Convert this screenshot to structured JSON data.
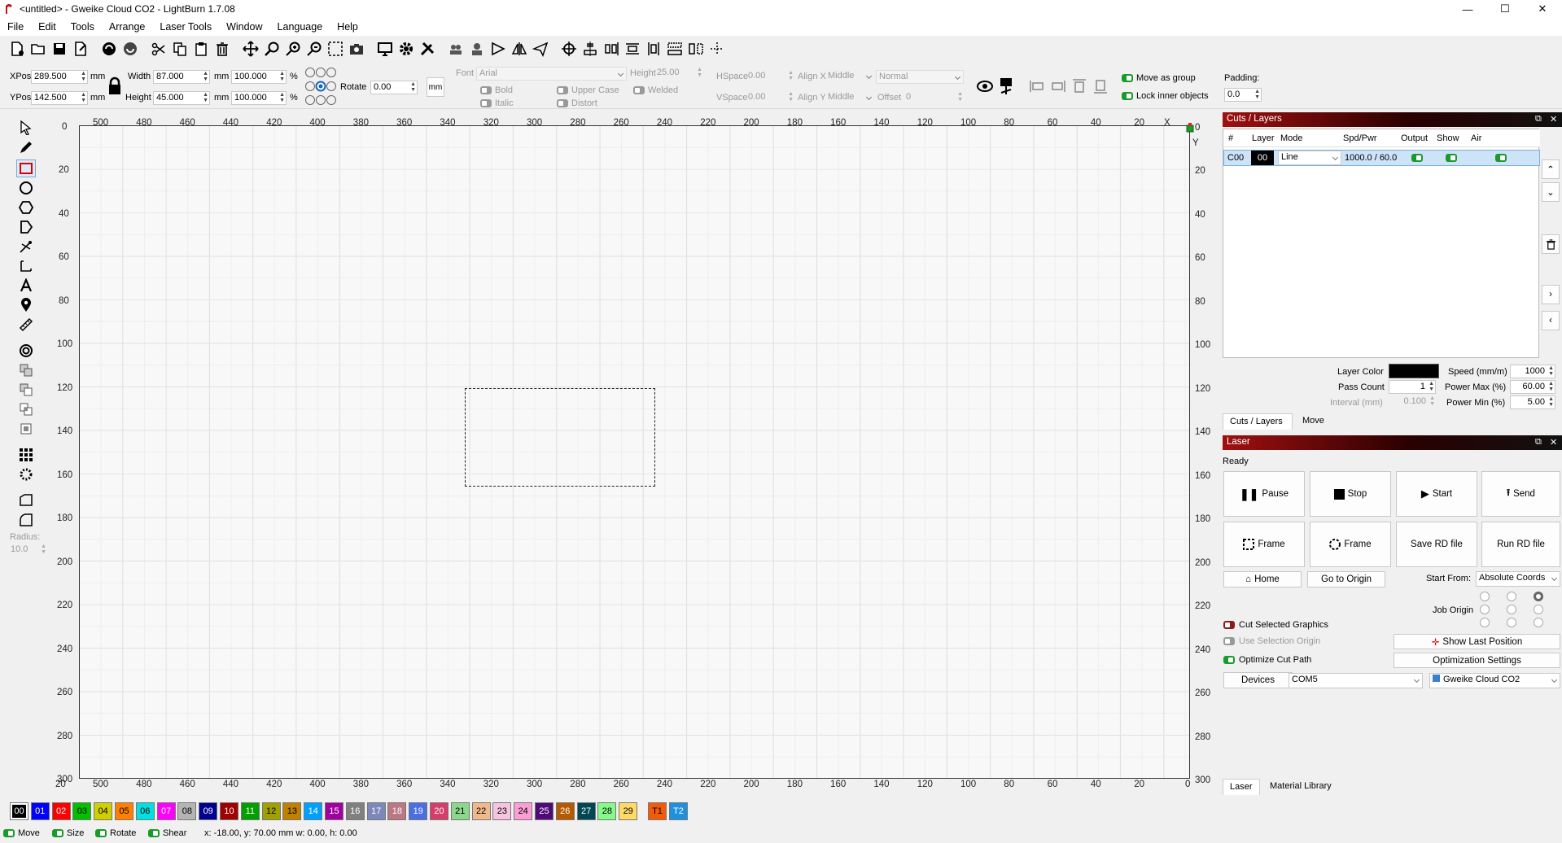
{
  "window": {
    "title": "<untitled> - Gweike Cloud CO2 - LightBurn 1.7.08",
    "minimize": "—",
    "maximize": "☐",
    "close": "✕"
  },
  "menu": [
    "File",
    "Edit",
    "Tools",
    "Arrange",
    "Laser Tools",
    "Window",
    "Language",
    "Help"
  ],
  "props": {
    "xpos_label": "XPos",
    "xpos": "289.500",
    "ypos_label": "YPos",
    "ypos": "142.500",
    "unit": "mm",
    "width_label": "Width",
    "width": "87.000",
    "height_label": "Height",
    "height": "45.000",
    "scale_w": "100.000",
    "scale_h": "100.000",
    "pct": "%",
    "rotate_label": "Rotate",
    "rotate": "0.00",
    "mm_btn": "mm"
  },
  "text_props": {
    "font_label": "Font",
    "font": "Arial",
    "height_label": "Height",
    "height": "25.00",
    "hspace_label": "HSpace",
    "hspace": "0.00",
    "vspace_label": "VSpace",
    "vspace": "0.00",
    "alignx_label": "Align X",
    "alignx": "Middle",
    "aligny_label": "Align Y",
    "aligny": "Middle",
    "style": "Normal",
    "offset_label": "Offset",
    "offset": "0",
    "bold": "Bold",
    "italic": "Italic",
    "upper": "Upper Case",
    "distort": "Distort",
    "welded": "Welded"
  },
  "group": {
    "move_as_group": "Move as group",
    "lock_inner": "Lock inner objects",
    "padding_label": "Padding:",
    "padding": "0.0"
  },
  "left": {
    "radius_label": "Radius:",
    "radius": "10.0"
  },
  "ruler": {
    "top": [
      "500",
      "480",
      "460",
      "440",
      "420",
      "400",
      "380",
      "360",
      "340",
      "320",
      "300",
      "280",
      "260",
      "240",
      "220",
      "200",
      "180",
      "160",
      "140",
      "120",
      "100",
      "80",
      "60",
      "40",
      "20",
      "X"
    ],
    "bottom": [
      "20",
      "500",
      "480",
      "460",
      "440",
      "420",
      "400",
      "380",
      "360",
      "340",
      "320",
      "300",
      "280",
      "260",
      "240",
      "220",
      "200",
      "180",
      "160",
      "140",
      "120",
      "100",
      "80",
      "60",
      "40",
      "20",
      "0"
    ],
    "left": [
      "0",
      "20",
      "40",
      "60",
      "80",
      "100",
      "120",
      "140",
      "160",
      "180",
      "200",
      "220",
      "240",
      "260",
      "280",
      "300"
    ],
    "right": [
      "0",
      "20",
      "40",
      "60",
      "80",
      "100",
      "120",
      "140",
      "160",
      "180",
      "200",
      "220",
      "240",
      "260",
      "280",
      "300"
    ],
    "y_label": "Y"
  },
  "cuts": {
    "title": "Cuts / Layers",
    "headers": [
      "#",
      "Layer",
      "Mode",
      "Spd/Pwr",
      "Output",
      "Show",
      "Air"
    ],
    "row": {
      "num": "C00",
      "layer": "00",
      "mode": "Line",
      "spdpwr": "1000.0 / 60.0"
    },
    "layer_color_label": "Layer Color",
    "speed_label": "Speed (mm/m)",
    "speed": "1000",
    "pass_label": "Pass Count",
    "pass": "1",
    "powmax_label": "Power Max (%)",
    "powmax": "60.00",
    "interval_label": "Interval (mm)",
    "interval": "0.100",
    "powmin_label": "Power Min (%)",
    "powmin": "5.00",
    "tabs": [
      "Cuts / Layers",
      "Move"
    ]
  },
  "laser": {
    "title": "Laser",
    "status": "Ready",
    "pause": "Pause",
    "stop": "Stop",
    "start": "Start",
    "send": "Send",
    "frame1": "Frame",
    "frame2": "Frame",
    "save_rd": "Save RD file",
    "run_rd": "Run RD file",
    "home": "Home",
    "go_origin": "Go to Origin",
    "start_from_label": "Start From:",
    "start_from": "Absolute Coords",
    "job_origin": "Job Origin",
    "cut_selected": "Cut Selected Graphics",
    "use_sel_origin": "Use Selection Origin",
    "optimize": "Optimize Cut Path",
    "show_last": "Show Last Position",
    "opt_settings": "Optimization Settings",
    "devices": "Devices",
    "port": "COM5",
    "device": "Gweike Cloud CO2",
    "tabs": [
      "Laser",
      "Material Library"
    ]
  },
  "palette": [
    {
      "l": "00",
      "c": "#000000",
      "t": "#fff"
    },
    {
      "l": "01",
      "c": "#0000ff",
      "t": "#fff"
    },
    {
      "l": "02",
      "c": "#ff0000",
      "t": "#fff"
    },
    {
      "l": "03",
      "c": "#00c000",
      "t": "#000"
    },
    {
      "l": "04",
      "c": "#d0d000",
      "t": "#000"
    },
    {
      "l": "05",
      "c": "#ff8000",
      "t": "#000"
    },
    {
      "l": "06",
      "c": "#00e0e0",
      "t": "#000"
    },
    {
      "l": "07",
      "c": "#ff00ff",
      "t": "#fff"
    },
    {
      "l": "08",
      "c": "#b4b4b4",
      "t": "#000"
    },
    {
      "l": "09",
      "c": "#000090",
      "t": "#fff"
    },
    {
      "l": "10",
      "c": "#a00000",
      "t": "#fff"
    },
    {
      "l": "11",
      "c": "#00a000",
      "t": "#fff"
    },
    {
      "l": "12",
      "c": "#a0a000",
      "t": "#000"
    },
    {
      "l": "13",
      "c": "#c08000",
      "t": "#000"
    },
    {
      "l": "14",
      "c": "#00a0ff",
      "t": "#fff"
    },
    {
      "l": "15",
      "c": "#a000a0",
      "t": "#fff"
    },
    {
      "l": "16",
      "c": "#808080",
      "t": "#fff"
    },
    {
      "l": "17",
      "c": "#7d87b9",
      "t": "#fff"
    },
    {
      "l": "18",
      "c": "#bb7784",
      "t": "#fff"
    },
    {
      "l": "19",
      "c": "#4a6fe3",
      "t": "#fff"
    },
    {
      "l": "20",
      "c": "#d33f6a",
      "t": "#fff"
    },
    {
      "l": "21",
      "c": "#8cd78c",
      "t": "#000"
    },
    {
      "l": "22",
      "c": "#f0b98d",
      "t": "#000"
    },
    {
      "l": "23",
      "c": "#f6c4e1",
      "t": "#000"
    },
    {
      "l": "24",
      "c": "#fa9ed4",
      "t": "#000"
    },
    {
      "l": "25",
      "c": "#500a78",
      "t": "#fff"
    },
    {
      "l": "26",
      "c": "#b45a00",
      "t": "#fff"
    },
    {
      "l": "27",
      "c": "#004754",
      "t": "#fff"
    },
    {
      "l": "28",
      "c": "#86fa88",
      "t": "#000"
    },
    {
      "l": "29",
      "c": "#ffdb66",
      "t": "#000"
    },
    {
      "l": "T1",
      "c": "#f35b06",
      "t": "#000"
    },
    {
      "l": "T2",
      "c": "#1e90e0",
      "t": "#fff"
    }
  ],
  "status": {
    "move": "Move",
    "size": "Size",
    "rotate": "Rotate",
    "shear": "Shear",
    "coords": "x: -18.00, y: 70.00 mm  w: 0.00,  h: 0.00"
  }
}
